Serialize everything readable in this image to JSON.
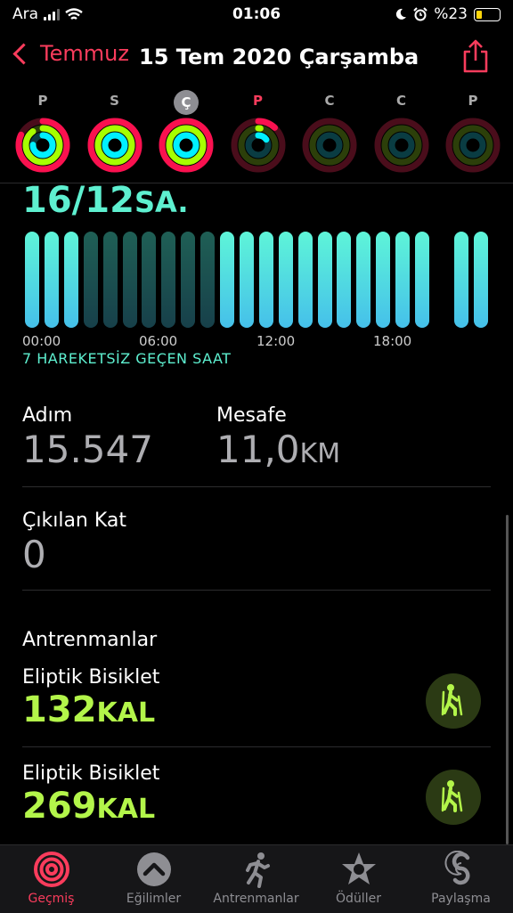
{
  "status": {
    "carrier": "Ara",
    "time": "01:06",
    "battery_text": "%23"
  },
  "nav": {
    "back_label": "Temmuz",
    "title": "15 Tem 2020 Çarşamba"
  },
  "week": [
    {
      "letter": "P",
      "style": "normal",
      "move": 0.82,
      "exercise": 0.9,
      "stand": 0.75
    },
    {
      "letter": "S",
      "style": "normal",
      "move": 1.0,
      "exercise": 1.0,
      "stand": 1.0
    },
    {
      "letter": "Ç",
      "style": "selected",
      "move": 1.0,
      "exercise": 1.0,
      "stand": 1.0
    },
    {
      "letter": "P",
      "style": "today",
      "move": 0.12,
      "exercise": 0.02,
      "stand": 0.15
    },
    {
      "letter": "C",
      "style": "normal",
      "move": 0,
      "exercise": 0,
      "stand": 0
    },
    {
      "letter": "C",
      "style": "normal",
      "move": 0,
      "exercise": 0,
      "stand": 0
    },
    {
      "letter": "P",
      "style": "normal",
      "move": 0,
      "exercise": 0,
      "stand": 0
    }
  ],
  "stand": {
    "value": "16/12",
    "unit": "SA.",
    "inactive_label": "7 HAREKETSİZ GEÇEN SAAT",
    "hours": [
      1,
      1,
      1,
      0,
      0,
      0,
      0,
      0,
      0,
      0,
      1,
      1,
      1,
      1,
      1,
      1,
      1,
      1,
      1,
      1,
      1,
      0,
      1,
      1
    ],
    "ticks": [
      "00:00",
      "06:00",
      "12:00",
      "18:00"
    ]
  },
  "stats": {
    "steps_label": "Adım",
    "steps_value": "15.547",
    "distance_label": "Mesafe",
    "distance_value": "11,0",
    "distance_unit": "KM",
    "floors_label": "Çıkılan Kat",
    "floors_value": "0"
  },
  "workouts": {
    "title": "Antrenmanlar",
    "items": [
      {
        "name": "Eliptik Bisiklet",
        "value": "132",
        "unit": "KAL"
      },
      {
        "name": "Eliptik Bisiklet",
        "value": "269",
        "unit": "KAL"
      }
    ]
  },
  "tabs": [
    "Geçmiş",
    "Eğilimler",
    "Antrenmanlar",
    "Ödüller",
    "Paylaşma"
  ],
  "colors": {
    "accent": "#fa3c5c",
    "move": "#fa114f",
    "exercise": "#a6ff00",
    "stand": "#00f0ff",
    "calories": "#b3f54a"
  }
}
